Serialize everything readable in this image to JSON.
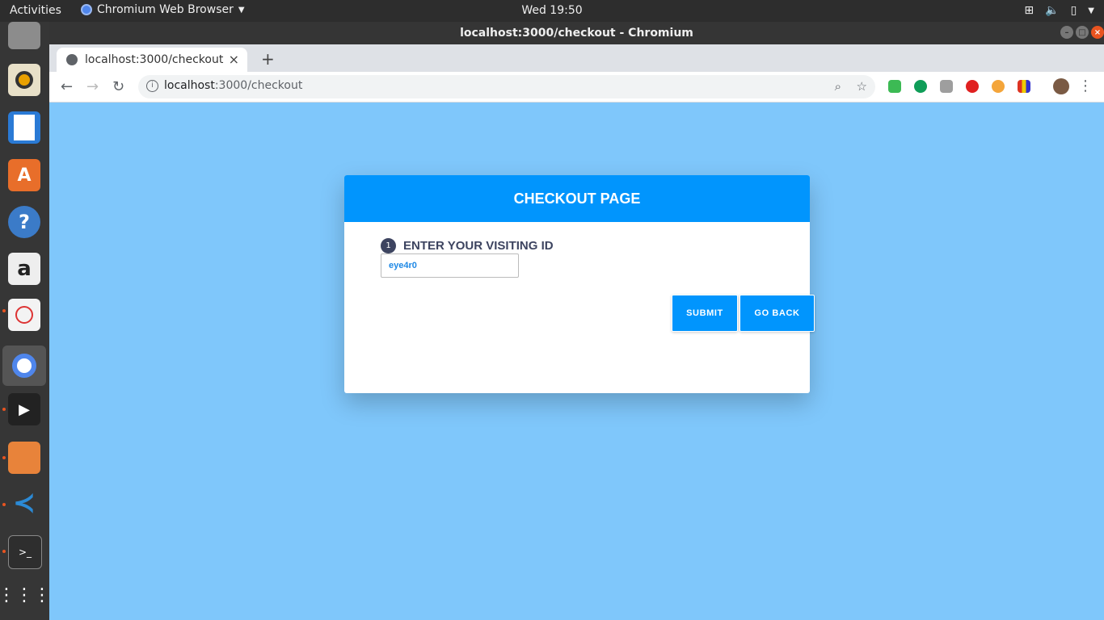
{
  "system_bar": {
    "activities": "Activities",
    "app_menu": "Chromium Web Browser",
    "clock": "Wed 19:50"
  },
  "dock": {
    "items": [
      "files",
      "rhythmbox",
      "writer",
      "software",
      "help",
      "amazon",
      "editor",
      "chromium",
      "media-player",
      "archive",
      "vscode",
      "terminal",
      "show-apps"
    ]
  },
  "window": {
    "title": "localhost:3000/checkout - Chromium"
  },
  "tab": {
    "label": "localhost:3000/checkout",
    "new_tab": "+"
  },
  "omnibox": {
    "host": "localhost",
    "path": ":3000/checkout"
  },
  "page": {
    "header": "CHECKOUT PAGE",
    "step_number": "1",
    "step_label": "ENTER YOUR VISITING ID",
    "visiting_id_value": "eye4r0",
    "submit_label": "SUBMIT",
    "go_back_label": "GO BACK"
  },
  "colors": {
    "page_background": "#7fc7fb",
    "accent": "#0195fd",
    "step_badge": "#3d4460"
  }
}
